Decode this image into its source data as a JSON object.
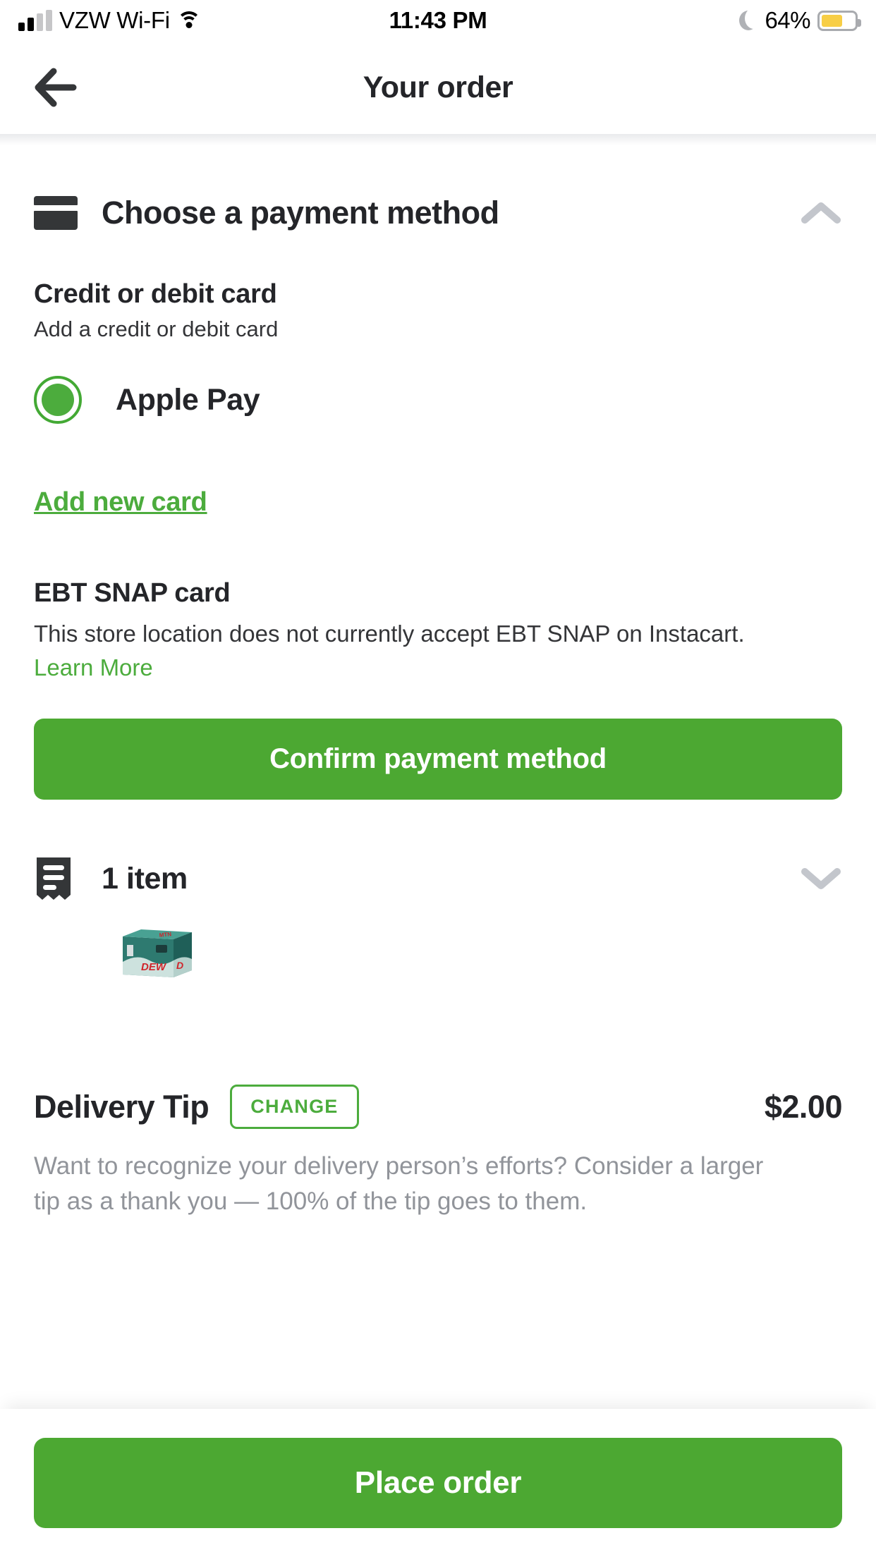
{
  "status_bar": {
    "carrier": "VZW Wi-Fi",
    "time": "11:43 PM",
    "battery_percent": "64%",
    "signal_bars_filled": 2,
    "signal_bars_total": 4,
    "battery_fill_color": "#f7ce46",
    "do_not_disturb": true
  },
  "nav": {
    "title": "Your order",
    "back_icon": "arrow-left-icon"
  },
  "payment_section": {
    "icon": "credit-card-icon",
    "title": "Choose a payment method",
    "collapse_icon": "chevron-up-icon",
    "credit_card": {
      "title": "Credit or debit card",
      "subtitle": "Add a credit or debit card"
    },
    "options": [
      {
        "label": "Apple Pay",
        "selected": true
      }
    ],
    "add_new_card_label": "Add new card",
    "ebt": {
      "title": "EBT SNAP card",
      "body": "This store location does not currently accept EBT SNAP on Instacart. ",
      "link_label": "Learn More"
    },
    "confirm_button_label": "Confirm payment method"
  },
  "items_section": {
    "icon": "receipt-icon",
    "count_label": "1 item",
    "expand_icon": "chevron-down-icon",
    "thumbnails": [
      {
        "name": "mountain-dew-12-pack",
        "alt": "Mountain Dew 12 pack box"
      }
    ]
  },
  "tip_section": {
    "label": "Delivery Tip",
    "change_button_label": "CHANGE",
    "amount": "$2.00",
    "description": "Want to recognize your delivery person’s efforts? Consider a larger tip as a thank you — 100% of the tip goes to them."
  },
  "footer": {
    "place_order_label": "Place order"
  },
  "colors": {
    "brand_green": "#4ca832",
    "link_green": "#4cac3d",
    "text_dark": "#242529",
    "text_muted": "#91949a",
    "chevron_gray": "#c3c6cc"
  }
}
